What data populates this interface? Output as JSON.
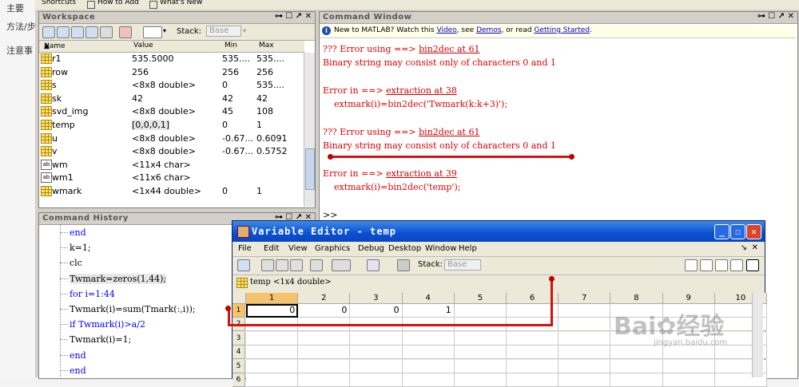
{
  "side_strip": [
    "主要",
    "方法/步",
    "注意事"
  ],
  "shortcuts": {
    "items": [
      "Shortcuts",
      "How to Add",
      "What's New"
    ]
  },
  "workspace": {
    "title": "Workspace",
    "stack_label": "Stack:",
    "stack_value": "Base",
    "columns": [
      "Name",
      "Value",
      "Min",
      "Max"
    ],
    "rows": [
      {
        "name": "r1",
        "value": "535.5000",
        "min": "535....",
        "max": "535....",
        "icon": "grid"
      },
      {
        "name": "row",
        "value": "256",
        "min": "256",
        "max": "256",
        "icon": "grid"
      },
      {
        "name": "s",
        "value": "<8x8 double>",
        "min": "0",
        "max": "535....",
        "icon": "grid"
      },
      {
        "name": "sk",
        "value": "42",
        "min": "42",
        "max": "42",
        "icon": "grid"
      },
      {
        "name": "svd_img",
        "value": "<8x8 double>",
        "min": "45",
        "max": "108",
        "icon": "grid"
      },
      {
        "name": "temp",
        "value": "[0,0,0,1]",
        "min": "0",
        "max": "1",
        "icon": "grid"
      },
      {
        "name": "u",
        "value": "<8x8 double>",
        "min": "-0.67...",
        "max": "0.6091",
        "icon": "grid"
      },
      {
        "name": "v",
        "value": "<8x8 double>",
        "min": "-0.67...",
        "max": "0.5752",
        "icon": "grid"
      },
      {
        "name": "wm",
        "value": "<11x4 char>",
        "min": "",
        "max": "",
        "icon": "ab"
      },
      {
        "name": "wm1",
        "value": "<11x6 char>",
        "min": "",
        "max": "",
        "icon": "ab"
      },
      {
        "name": "wmark",
        "value": "<1x44 double>",
        "min": "0",
        "max": "1",
        "icon": "grid"
      }
    ]
  },
  "command_window": {
    "title": "Command Window",
    "info": {
      "prefix": "New to MATLAB? Watch this",
      "video": "Video",
      "sep1": ", see",
      "demos": "Demos",
      "sep2": ", or read",
      "getting_started": "Getting Started",
      "end": "."
    },
    "lines": [
      {
        "text": "??? Error using ==> ",
        "link": "bin2dec at 61"
      },
      {
        "text": "Binary string may consist only of characters 0 and 1",
        "link": ""
      },
      {
        "text": "",
        "link": ""
      },
      {
        "text": "Error in ==> ",
        "link": "extraction at 38"
      },
      {
        "text": "    extmark(i)=bin2dec('Twmark(k:k+3)');",
        "link": ""
      },
      {
        "text": "",
        "link": ""
      },
      {
        "text": "??? Error using ==> ",
        "link": "bin2dec at 61"
      },
      {
        "text": "Binary string may consist only of characters 0 and 1",
        "link": ""
      },
      {
        "text": "",
        "link": ""
      },
      {
        "text": "Error in ==> ",
        "link": "extraction at 39"
      },
      {
        "text": "    extmark(i)=bin2dec('temp');",
        "link": ""
      },
      {
        "text": "",
        "link": ""
      },
      {
        "text": ">>",
        "link": ""
      }
    ]
  },
  "history": {
    "title": "Command History",
    "lines": [
      {
        "text": "end",
        "kw": true
      },
      {
        "text": "k=1;",
        "kw": false
      },
      {
        "text": "clc",
        "kw": false
      },
      {
        "text": "Twmark=zeros(1,44);",
        "kw": false,
        "highlight": true
      },
      {
        "text": "for i=1:44",
        "kw": true
      },
      {
        "text": "Twmark(i)=sum(Tmark(:,i));",
        "kw": false
      },
      {
        "text": "if Twmark(i)>a/2",
        "kw": true
      },
      {
        "text": "Twmark(i)=1;",
        "kw": false
      },
      {
        "text": "end",
        "kw": true
      },
      {
        "text": "end",
        "kw": true
      }
    ]
  },
  "variable_editor": {
    "title": "Variable Editor - temp",
    "menu": [
      "File",
      "Edit",
      "View",
      "Graphics",
      "Debug",
      "Desktop",
      "Window",
      "Help"
    ],
    "stack_label": "Stack:",
    "stack_value": "Base",
    "var_label": "temp <1x4 double>",
    "columns": [
      "1",
      "2",
      "3",
      "4",
      "5",
      "6",
      "7",
      "8",
      "9",
      "10"
    ],
    "rows": [
      "1",
      "2",
      "3",
      "4",
      "5",
      "6"
    ],
    "values": [
      "0",
      "0",
      "0",
      "1"
    ]
  },
  "watermark": {
    "main": "Bai",
    "cn": "经验",
    "sub": "jingyan.baidu.com"
  },
  "colors": {
    "error_red": "#e00000",
    "title_blue": "#0a4fd1",
    "annotation_red": "#d81010"
  }
}
